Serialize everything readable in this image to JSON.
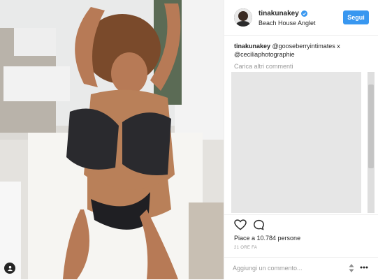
{
  "post": {
    "username": "tinakunakey",
    "location": "Beach House Anglet",
    "follow_label": "Segui"
  },
  "caption": {
    "username": "tinakunakey",
    "text": " @gooseberryintimates x @ceciliaphotographie"
  },
  "comments": {
    "load_more": "Carica altri commenti"
  },
  "stats": {
    "likes": "Piace a 10.784 persone",
    "timestamp": "21 ORE FA"
  },
  "composer": {
    "placeholder": "Aggiungi un commento..."
  },
  "icons": {
    "heart": "heart-icon",
    "comment": "comment-icon",
    "verified": "verified-badge-icon",
    "more": "more-options-icon",
    "sort": "sort-arrows-icon",
    "tag": "user-tag-icon"
  },
  "colors": {
    "follow_button": "#3897f0",
    "verified": "#3897f0",
    "text": "#262626",
    "muted": "#999999"
  }
}
